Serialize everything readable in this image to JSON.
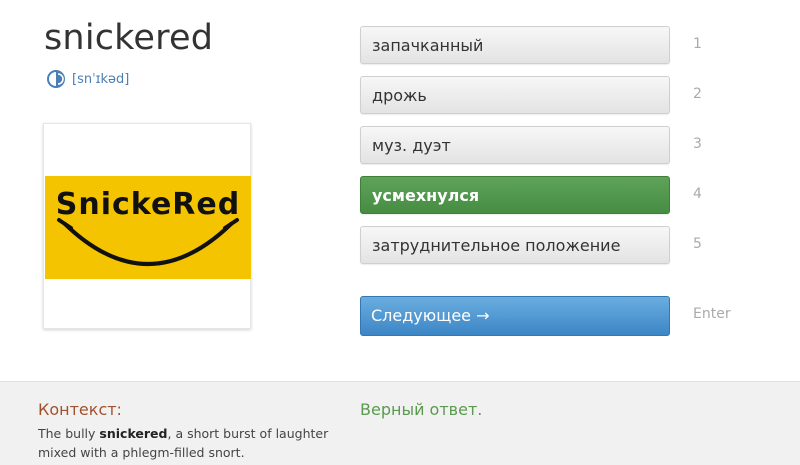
{
  "word": {
    "text": "snickered",
    "transcription": "[snˈɪkəd]",
    "sound_icon": "speaker-icon"
  },
  "picture": {
    "logo_text": "SnickeRed",
    "background_color": "#f5c400"
  },
  "options": [
    {
      "label": "запачканный",
      "key": "1",
      "state": "default"
    },
    {
      "label": "дрожь",
      "key": "2",
      "state": "default"
    },
    {
      "label": "муз. дуэт",
      "key": "3",
      "state": "default"
    },
    {
      "label": "усмехнулся",
      "key": "4",
      "state": "correct"
    },
    {
      "label": "затруднительное положение",
      "key": "5",
      "state": "default"
    }
  ],
  "next": {
    "label": "Следующее →",
    "hint": "Enter"
  },
  "context": {
    "title": "Контекст:",
    "before": "The bully ",
    "highlight": "snickered",
    "after": ", a short burst of laughter mixed with a phlegm-filled snort."
  },
  "result": {
    "text": "Верный ответ."
  },
  "colors": {
    "correct": "#4f944b",
    "next": "#4a90d0",
    "link": "#4a7fb5",
    "context_title": "#a0522d"
  }
}
